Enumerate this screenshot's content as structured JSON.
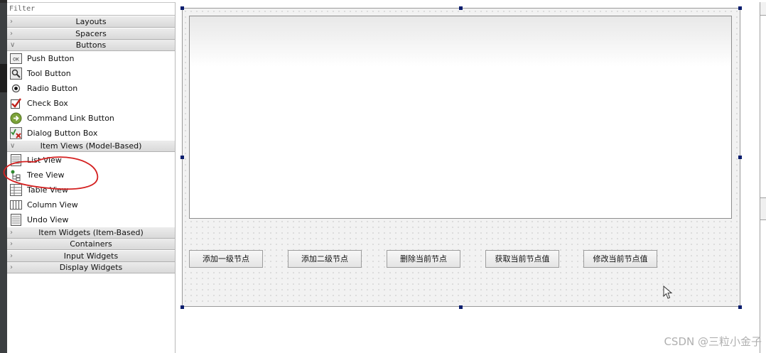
{
  "widget_box": {
    "filter_placeholder": "Filter",
    "categories": {
      "layouts": "Layouts",
      "spacers": "Spacers",
      "buttons": "Buttons",
      "item_views": "Item Views (Model-Based)",
      "item_widgets": "Item Widgets (Item-Based)",
      "containers": "Containers",
      "input_widgets": "Input Widgets",
      "display_widgets": "Display Widgets"
    },
    "buttons_items": {
      "push_button": "Push Button",
      "tool_button": "Tool Button",
      "radio_button": "Radio Button",
      "check_box": "Check Box",
      "command_link_button": "Command Link Button",
      "dialog_button_box": "Dialog Button Box"
    },
    "item_view_items": {
      "list_view": "List View",
      "tree_view": "Tree View",
      "table_view": "Table View",
      "column_view": "Column View",
      "undo_view": "Undo View"
    },
    "push_button_icon_text": "OK"
  },
  "form": {
    "buttons": {
      "add_top_node": "添加一级节点",
      "add_child_node": "添加二级节点",
      "delete_node": "删除当前节点",
      "get_node_value": "获取当前节点值",
      "edit_node_value": "修改当前节点值"
    }
  },
  "watermark": "CSDN @三粒小金子",
  "colors": {
    "selection_handle": "#0a1d6e",
    "annotation": "#d42020",
    "category_header": "#e2e2e2"
  }
}
